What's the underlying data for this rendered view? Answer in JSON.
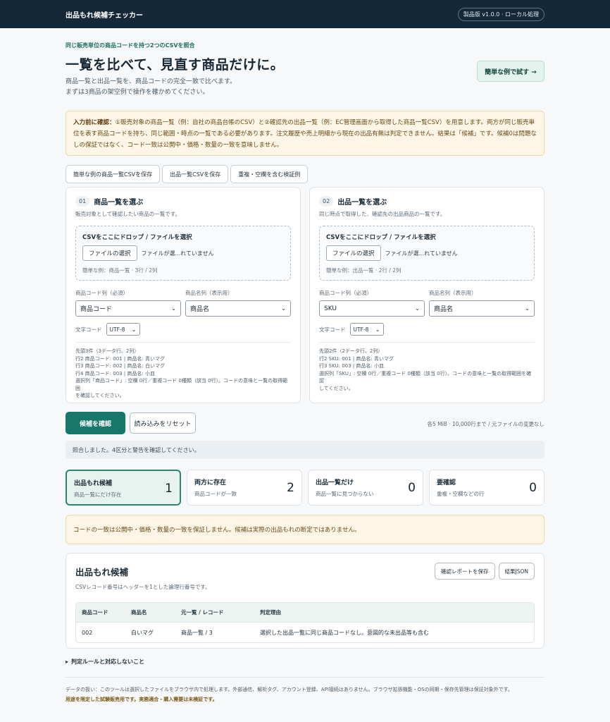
{
  "header": {
    "app_title": "出品もれ候補チェッカー",
    "version": "製品版 v1.0.0 · ローカル処理"
  },
  "hero": {
    "eyebrow": "同じ販売単位の商品コードを持つ2つのCSVを照合",
    "title": "一覧を比べて、見直す商品だけに。",
    "desc_line1": "商品一覧と出品一覧を、商品コードの完全一致で比べます。",
    "desc_line2": "まずは3商品の架空例で操作を確かめてください。",
    "try_button": "簡単な例で試す →"
  },
  "warning": {
    "lead": "入力前に確認：",
    "text": "①販売対象の商品一覧（例：自社の商品台帳のCSV）と②確認先の出品一覧（例：EC管理画面から取得した商品一覧CSV）を用意します。両方が同じ販売単位を表す商品コードを持ち、同じ範囲・時点の一覧である必要があります。注文履歴や売上明細から現在の出品有無は判定できません。結果は「候補」です。候補0は問題なしの保証ではなく、コード一致は公開中・価格・数量の一致を意味しません。"
  },
  "sample_buttons": [
    "簡単な例の商品一覧CSVを保存",
    "出品一覧CSVを保存",
    "重複・空欄を含む検証例"
  ],
  "panels": [
    {
      "num": "01",
      "title": "商品一覧を選ぶ",
      "desc": "販売対象として確認したい商品の一覧です。",
      "drop_label": "CSVをここにドロップ / ファイルを選択",
      "file_button": "ファイルの選択",
      "file_status": "ファイルが選...れていません",
      "sample_note": "簡単な例：商品一覧 · 3行 / 2列",
      "code_label": "商品コード列（必須）",
      "code_value": "商品コード",
      "name_label": "商品名列（表示用）",
      "name_value": "商品名",
      "enc_label": "文字コード",
      "enc_value": "UTF-8",
      "preview": [
        "先頭3件（3データ行、2列）",
        "行2  商品コード: 001 | 商品名: 青いマグ",
        "行3  商品コード: 002 | 商品名: 白いマグ",
        "行4  商品コード: 003 | 商品名: 小皿",
        "選択列「商品コード」: 空欄 0行／重複コード 0種類（該当 0行）。コードの意味と一覧の取得範囲",
        "を確認してください。"
      ]
    },
    {
      "num": "02",
      "title": "出品一覧を選ぶ",
      "desc": "同じ時点で取得した、確認先の出品商品の一覧です。",
      "drop_label": "CSVをここにドロップ / ファイルを選択",
      "file_button": "ファイルの選択",
      "file_status": "ファイルが選...れていません",
      "sample_note": "簡単な例：出品一覧 · 2行 / 2列",
      "code_label": "商品コード列（必須）",
      "code_value": "SKU",
      "name_label": "商品名列（表示用）",
      "name_value": "商品名",
      "enc_label": "文字コード",
      "enc_value": "UTF-8",
      "preview": [
        "先頭2件（2データ行、2列）",
        "行2  SKU: 001 | 商品名: 青いマグ",
        "行3  SKU: 003 | 商品名: 小皿",
        "選択列「SKU」: 空欄 0行／重複コード 0種類（該当 0行）。コードの意味と一覧の取得範囲を確認",
        "してください。"
      ]
    }
  ],
  "actions": {
    "confirm": "候補を確認",
    "reset": "読み込みをリセット",
    "limit": "各5 MiB · 10,000行まで / 元ファイルの変更なし"
  },
  "status": "照合しました。4区分と警告を確認してください。",
  "cards": [
    {
      "title": "出品もれ候補",
      "sub": "商品一覧にだけ存在",
      "count": "1"
    },
    {
      "title": "両方に存在",
      "sub": "商品コードが一致",
      "count": "2"
    },
    {
      "title": "出品一覧だけ",
      "sub": "商品一覧に見つからない",
      "count": "0"
    },
    {
      "title": "要確認",
      "sub": "重複・空欄などの行",
      "count": "0"
    }
  ],
  "notice": "コードの一致は公開中・価格・数量の一致を保証しません。候補は実際の出品もれの断定ではありません。",
  "results": {
    "title": "出品もれ候補",
    "sub": "CSVレコード番号はヘッダーを1とした論理行番号です。",
    "save_report": "確認レポートを保存",
    "json": "結果JSON",
    "columns": [
      "商品コード",
      "商品名",
      "元一覧 / レコード",
      "判定理由"
    ],
    "rows": [
      [
        "002",
        "白いマグ",
        "商品一覧 / 3",
        "選択した出品一覧に同じ商品コードなし。意図的な未出品等も含む"
      ]
    ]
  },
  "details_label": "判定ルールと対応しないこと",
  "footer": {
    "line1": "データの扱い：このツールは選択したファイルをブラウザ内で処理します。外部通信、解析タグ、アカウント登録、API接続はありません。ブラウザ拡張機能・OSの同期・保存先管理は保証対象外です。",
    "line2": "用途を限定した試験販売用です。実務適合・購入需要は未検証です。"
  }
}
